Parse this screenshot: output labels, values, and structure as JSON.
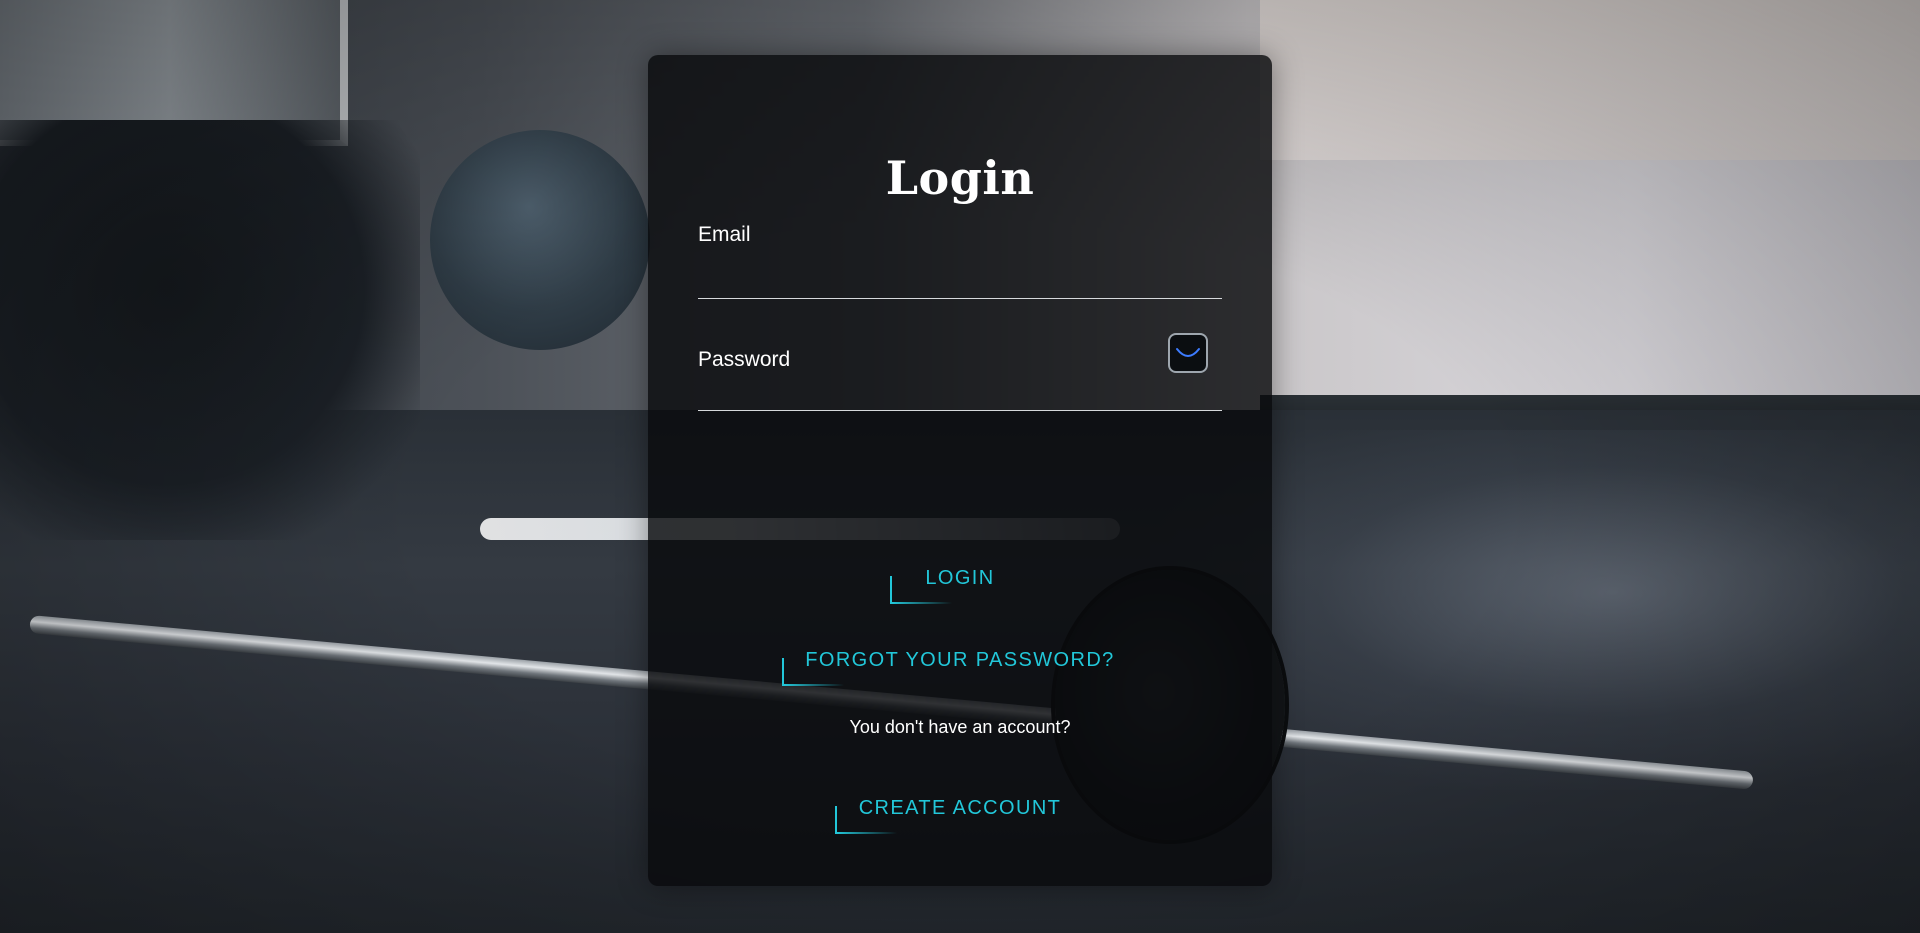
{
  "login_form": {
    "title": "Login",
    "email": {
      "label": "Email",
      "value": ""
    },
    "password": {
      "label": "Password",
      "value": "",
      "toggle_icon": "eye-closed-icon"
    },
    "login_label": "LOGIN",
    "forgot_label": "FORGOT YOUR PASSWORD?",
    "no_account_text": "You don't have an account?",
    "create_account_label": "CREATE ACCOUNT"
  },
  "colors": {
    "accent": "#22c7d9",
    "card_background": "#080a0c",
    "text": "#ffffff"
  }
}
